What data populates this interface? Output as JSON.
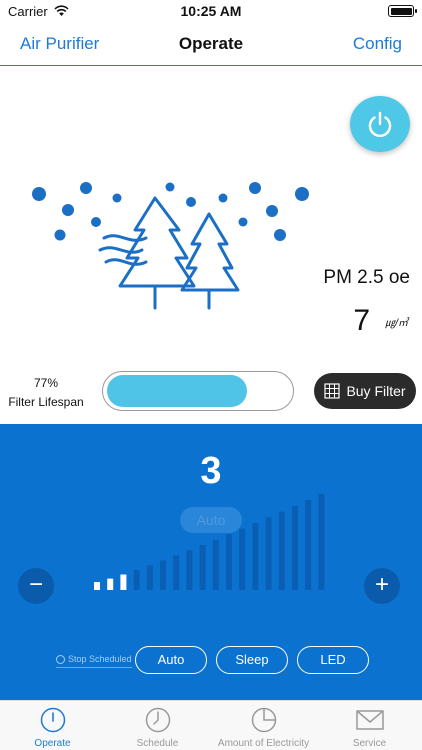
{
  "status_bar": {
    "carrier": "Carrier",
    "time": "10:25 AM"
  },
  "nav": {
    "back_label": "Air Purifier",
    "title": "Operate",
    "config_label": "Config"
  },
  "power": {
    "icon": "power-icon",
    "accent": "#4fc8e8"
  },
  "illustration": {
    "icon": "trees-and-dots"
  },
  "air_quality": {
    "pm_label": "PM 2.5 oe",
    "pm_value": "7",
    "unit": "㎍/㎥"
  },
  "filter": {
    "percent_text": "77%",
    "label": "Filter Lifespan",
    "fraction": 0.77,
    "buy_label": "Buy Filter"
  },
  "control": {
    "fan_level": "3",
    "mode_label": "Auto",
    "bars_total": 18,
    "bars_active": 3,
    "minus_label": "−",
    "plus_label": "+",
    "stop_scheduled_label": "Stop Scheduled",
    "options": [
      "Auto",
      "Sleep",
      "LED"
    ],
    "panel_color": "#0b72d0"
  },
  "tabs": [
    {
      "label": "Operate",
      "icon": "power-icon",
      "active": true
    },
    {
      "label": "Schedule",
      "icon": "clock-icon",
      "active": false
    },
    {
      "label": "Amount of Electricity",
      "icon": "pie-chart-icon",
      "active": false
    },
    {
      "label": "Service",
      "icon": "mail-icon",
      "active": false
    }
  ]
}
